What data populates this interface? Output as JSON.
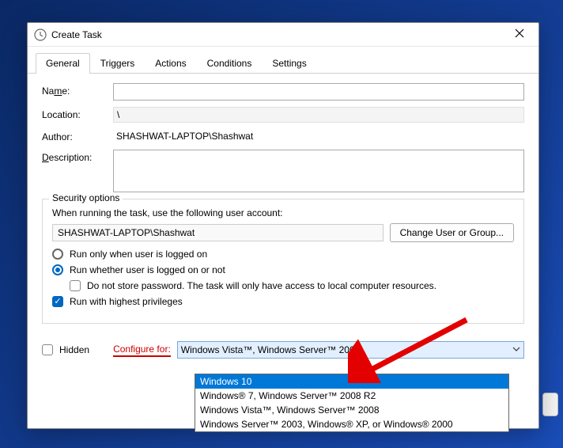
{
  "window": {
    "title": "Create Task"
  },
  "tabs": [
    "General",
    "Triggers",
    "Actions",
    "Conditions",
    "Settings"
  ],
  "fields": {
    "name_label": "Name:",
    "name_value": "",
    "location_label": "Location:",
    "location_value": "\\",
    "author_label": "Author:",
    "author_value": "SHASHWAT-LAPTOP\\Shashwat",
    "description_label": "Description:",
    "description_value": ""
  },
  "security": {
    "legend": "Security options",
    "prompt": "When running the task, use the following user account:",
    "account": "SHASHWAT-LAPTOP\\Shashwat",
    "change_btn": "Change User or Group...",
    "radio_logged_on": "Run only when user is logged on",
    "radio_logged_or_not": "Run whether user is logged on or not",
    "no_store_pwd": "Do not store password.  The task will only have access to local computer resources.",
    "highest_priv": "Run with highest privileges"
  },
  "footer": {
    "hidden_label": "Hidden",
    "configure_label": "Configure for:",
    "combo_value": "Windows Vista™, Windows Server™ 2008"
  },
  "dropdown": [
    "Windows 10",
    "Windows® 7, Windows Server™ 2008 R2",
    "Windows Vista™, Windows Server™ 2008",
    "Windows Server™ 2003, Windows® XP, or Windows® 2000"
  ]
}
